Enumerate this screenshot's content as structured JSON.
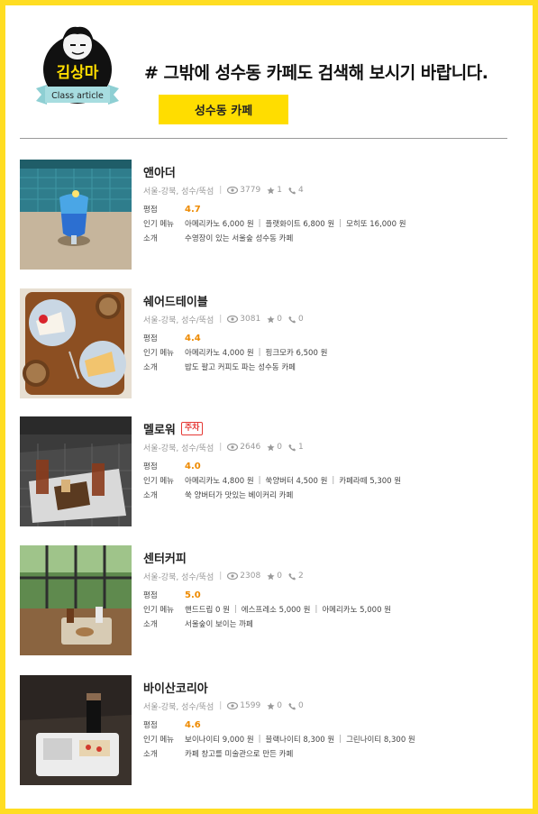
{
  "logo": {
    "name": "김상마",
    "ribbon": "Class article"
  },
  "headline": "# 그밖에 성수동 카페도 검색해 보시기 바랍니다.",
  "tag_button": "성수동 카페",
  "labels": {
    "rating": "평점",
    "menu": "인기 메뉴",
    "intro": "소개"
  },
  "accent_colors": {
    "border": "#ffdd22",
    "button": "#ffdd00",
    "rating": "#ee8a00",
    "badge": "#e53935"
  },
  "cafes": [
    {
      "name": "앤아더",
      "badge": "",
      "region": "서울-강북, 성수/뚝섬",
      "views": "3779",
      "stars": "1",
      "calls": "4",
      "rating": "4.7",
      "menus": [
        "아메리카노 6,000 원",
        "플랫화이트 6,800 원",
        "모히또 16,000 원"
      ],
      "intro": "수영장이 있는 서울숲 성수동 카페"
    },
    {
      "name": "쉐어드테이블",
      "badge": "",
      "region": "서울-강북, 성수/뚝섬",
      "views": "3081",
      "stars": "0",
      "calls": "0",
      "rating": "4.4",
      "menus": [
        "아메리카노 4,000 원",
        "핑크모카 6,500 원"
      ],
      "intro": "밥도 팔고 커피도 파는 성수동 카페"
    },
    {
      "name": "멜로워",
      "badge": "주차",
      "region": "서울-강북, 성수/뚝섬",
      "views": "2646",
      "stars": "0",
      "calls": "1",
      "rating": "4.0",
      "menus": [
        "아메리카노 4,800 원",
        "쑥양버터 4,500 원",
        "카페라떼 5,300 원"
      ],
      "intro": "쑥 양버터가 맛있는 베이커리 카페"
    },
    {
      "name": "센터커피",
      "badge": "",
      "region": "서울-강북, 성수/뚝섬",
      "views": "2308",
      "stars": "0",
      "calls": "2",
      "rating": "5.0",
      "menus": [
        "핸드드립 0 원",
        "에스프레소 5,000 원",
        "아메리카노 5,000 원"
      ],
      "intro": "서울숲이 보이는 까페"
    },
    {
      "name": "바이산코리아",
      "badge": "",
      "region": "서울-강북, 성수/뚝섬",
      "views": "1599",
      "stars": "0",
      "calls": "0",
      "rating": "4.6",
      "menus": [
        "보이나이티 9,000 원",
        "블랙나이티 8,300 원",
        "그린나이티 8,300 원"
      ],
      "intro": "카페 창고를 미술관으로 만든 카페"
    }
  ]
}
